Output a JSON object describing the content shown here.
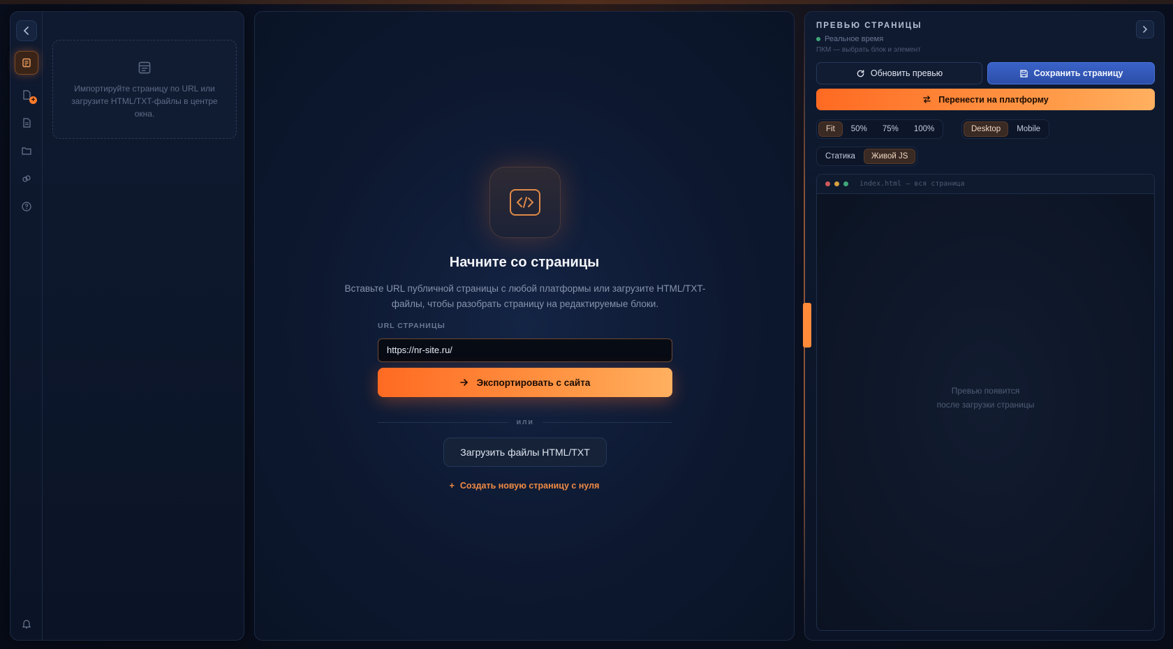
{
  "left_panel": {
    "import_hint": "Импортируйте страницу по URL или загрузите HTML/TXT-файлы в центре окна."
  },
  "center": {
    "title": "Начните со страницы",
    "subtitle": "Вставьте URL публичной страницы с любой платформы или загрузите HTML/TXT-файлы, чтобы разобрать страницу на редактируемые блоки.",
    "url_label": "URL СТРАНИЦЫ",
    "url_value": "https://nr-site.ru/",
    "export_label": "Экспортировать с сайта",
    "or_label": "или",
    "upload_label": "Загрузить файлы HTML/TXT",
    "create_label": "Создать новую страницу с нуля"
  },
  "preview": {
    "title": "ПРЕВЬЮ СТРАНИЦЫ",
    "live_label": "Реальное время",
    "hint": "ПКМ — выбрать блок и элемент",
    "refresh_label": "Обновить превью",
    "save_label": "Сохранить страницу",
    "migrate_label": "Перенести на платформу",
    "zoom": [
      "Fit",
      "50%",
      "75%",
      "100%"
    ],
    "zoom_selected": "Fit",
    "device": [
      "Desktop",
      "Mobile"
    ],
    "device_selected": "Desktop",
    "mode": [
      "Статика",
      "Живой JS"
    ],
    "mode_selected": "Живой JS",
    "file_name": "index.html — вся страница",
    "empty_line1": "Превью появится",
    "empty_line2": "после загрузки страницы"
  },
  "colors": {
    "accent": "#ff7a2a",
    "primary_blue": "#3a62c8",
    "live_green": "#3fa878"
  },
  "icons": {
    "rail": [
      "chevron-left-icon",
      "pages-icon",
      "file-add-icon",
      "document-icon",
      "folder-icon",
      "link-icon",
      "help-icon",
      "bell-icon"
    ],
    "tile": "code-icon"
  }
}
